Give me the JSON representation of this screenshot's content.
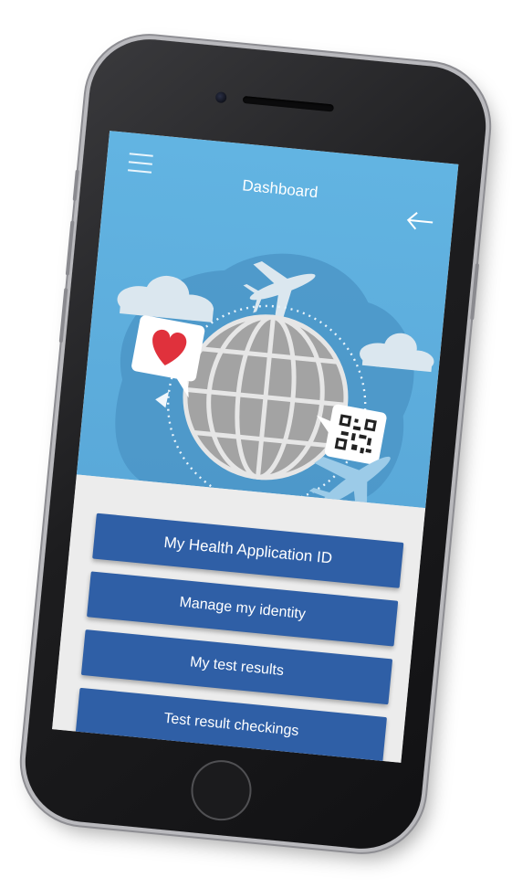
{
  "header": {
    "title": "Dashboard"
  },
  "icons": {
    "menu": "hamburger-menu-icon",
    "back": "arrow-left-icon"
  },
  "illustration_icons": [
    "cloud",
    "airplane",
    "heart",
    "globe",
    "qr-code"
  ],
  "menu": {
    "items": [
      {
        "label": "My Health Application ID"
      },
      {
        "label": "Manage my identity"
      },
      {
        "label": "My test results"
      },
      {
        "label": "Test result checkings"
      }
    ]
  },
  "colors": {
    "header_blue": "#62b4e2",
    "button_blue": "#2f5fa6",
    "heart_red": "#e0313c",
    "globe_gray": "#9a9a9a",
    "background": "#ececec"
  }
}
